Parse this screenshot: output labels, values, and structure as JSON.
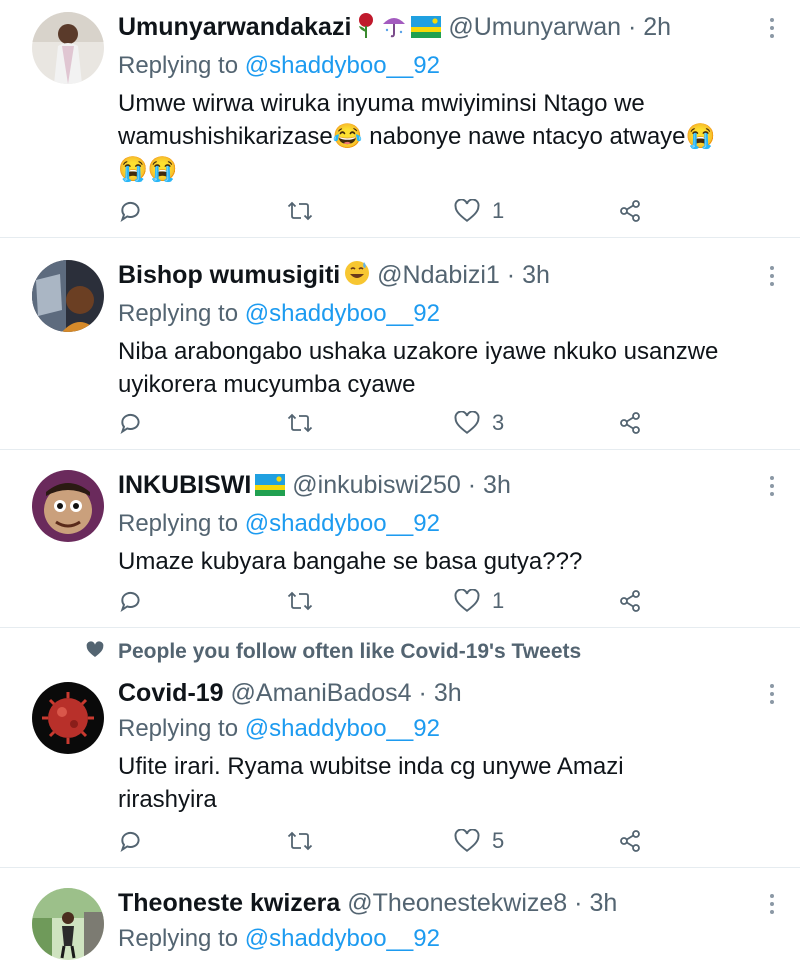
{
  "tweets": [
    {
      "name": "Umunyarwandakazi",
      "handle": "@Umunyarwan",
      "time": "2h",
      "replying_prefix": "Replying to",
      "replying_to": "@shaddyboo__92",
      "text_lines": [
        "Umwe wirwa wiruka inyuma mwiyiminsi Ntago we",
        "wamushishikarizase😂 nabonye nawe ntacyo atwaye😭",
        "😭😭"
      ],
      "likes": "1",
      "name_emojis": [
        "rose-emoji",
        "umbrella-emoji",
        "rwanda-flag-emoji"
      ]
    },
    {
      "name": "Bishop wumusigiti",
      "handle": "@Ndabizi1",
      "time": "3h",
      "replying_prefix": "Replying to",
      "replying_to": "@shaddyboo__92",
      "text_lines": [
        "Niba arabongabo ushaka uzakore iyawe nkuko usanzwe",
        "uyikorera mucyumba cyawe"
      ],
      "likes": "3",
      "name_emojis": [
        "grinning-sweat-emoji"
      ]
    },
    {
      "name": "INKUBISWI",
      "handle": "@inkubiswi250",
      "time": "3h",
      "replying_prefix": "Replying to",
      "replying_to": "@shaddyboo__92",
      "text_lines": [
        "Umaze kubyara bangahe se basa gutya???"
      ],
      "likes": "1",
      "name_emojis": [
        "rwanda-flag-emoji"
      ]
    },
    {
      "name": "Covid-19",
      "handle": "@AmaniBados4",
      "time": "3h",
      "replying_prefix": "Replying to",
      "replying_to": "@shaddyboo__92",
      "text_lines": [
        "Ufite irari. Ryama wubitse inda cg unywe Amazi",
        "rirashyira"
      ],
      "likes": "5",
      "name_emojis": []
    },
    {
      "name": "Theoneste kwizera",
      "handle": "@Theonestekwize8",
      "time": "3h",
      "replying_prefix": "Replying to",
      "replying_to": "@shaddyboo__92",
      "text_lines": [],
      "likes": "",
      "name_emojis": []
    }
  ],
  "social_context": "People you follow often like Covid-19's Tweets",
  "separator": "·",
  "colors": {
    "text": "#0f1419",
    "secondary": "#536471",
    "link": "#1d9bf0",
    "divider": "#e6ecf0"
  },
  "icons": [
    "reply-icon",
    "retweet-icon",
    "like-icon",
    "share-icon",
    "more-icon",
    "heart-filled-icon"
  ]
}
